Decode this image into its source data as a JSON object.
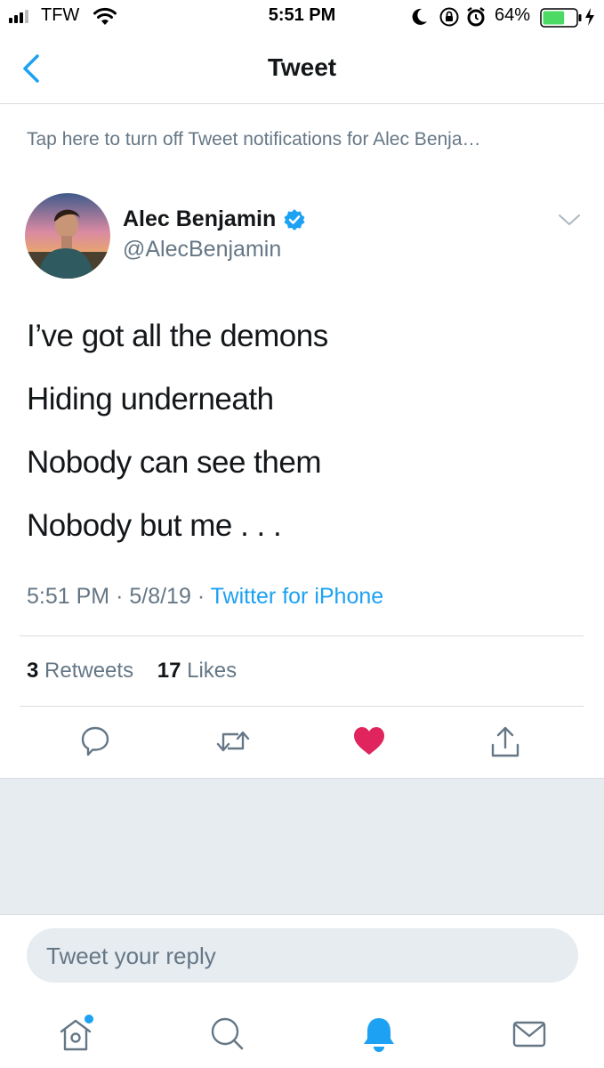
{
  "status_bar": {
    "carrier": "TFW",
    "time": "5:51 PM",
    "battery_percent": "64%",
    "battery_level": 0.64,
    "battery_color": "#4cd964"
  },
  "nav": {
    "title": "Tweet"
  },
  "notification_banner": "Tap here to turn off Tweet notifications for Alec Benja…",
  "tweet": {
    "author_name": "Alec Benjamin",
    "author_handle": "@AlecBenjamin",
    "verified": true,
    "lines": [
      "I’ve got all the demons",
      "Hiding underneath",
      "Nobody can see them",
      "Nobody but me . . ."
    ],
    "time": "5:51 PM",
    "date": "5/8/19",
    "source": "Twitter for iPhone",
    "separator": "·",
    "retweet_count": "3",
    "retweet_label": "Retweets",
    "like_count": "17",
    "like_label": "Likes",
    "liked": true
  },
  "reply_box": {
    "placeholder": "Tweet your reply"
  },
  "tab_bar": {
    "items": [
      "home-icon",
      "search-icon",
      "notifications-icon",
      "messages-icon"
    ],
    "active": "notifications-icon",
    "home_has_dot": true
  },
  "colors": {
    "accent": "#1da1f2",
    "like": "#e0245e",
    "secondary_text": "#657786",
    "divider": "#d9dde1"
  }
}
